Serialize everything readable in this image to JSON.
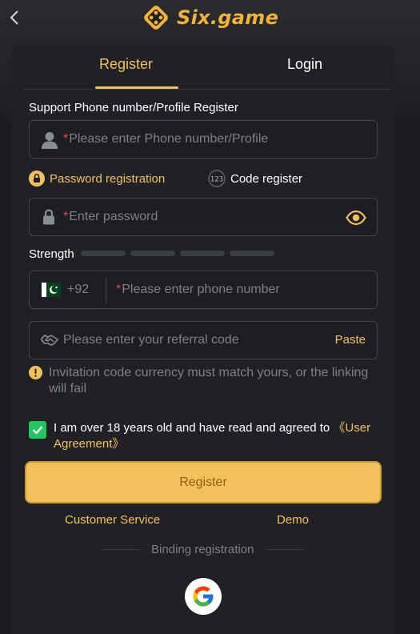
{
  "brand": {
    "name": "Six.game",
    "accent": "#f2c15c"
  },
  "tabs": {
    "register": "Register",
    "login": "Login"
  },
  "phone_register": {
    "label": "Support Phone number/Profile Register",
    "required_mark": "*",
    "placeholder": "Please enter Phone number/Profile"
  },
  "modes": {
    "password": "Password registration",
    "code": "Code register",
    "code_badge": "123"
  },
  "password": {
    "required_mark": "*",
    "placeholder": "Enter password"
  },
  "strength": {
    "label": "Strength",
    "level": 0,
    "segments": 4
  },
  "phone": {
    "country_code": "+92",
    "required_mark": "*",
    "placeholder": "Please enter phone number"
  },
  "referral": {
    "placeholder": "Please enter your referral code",
    "paste": "Paste"
  },
  "notice": "Invitation code currency must match yours, or the linking will fail",
  "agreement": {
    "text": "I am over 18 years old and have read and agreed to ",
    "link": "《User Agreement》",
    "checked": true
  },
  "actions": {
    "register": "Register",
    "customer_service": "Customer Service",
    "demo": "Demo",
    "binding": "Binding registration"
  },
  "icons": [
    "back-chevron-icon",
    "logo-icon",
    "user-icon",
    "lock-icon",
    "eye-icon",
    "pakistan-flag-icon",
    "handshake-icon",
    "warning-icon",
    "check-icon",
    "google-icon"
  ]
}
